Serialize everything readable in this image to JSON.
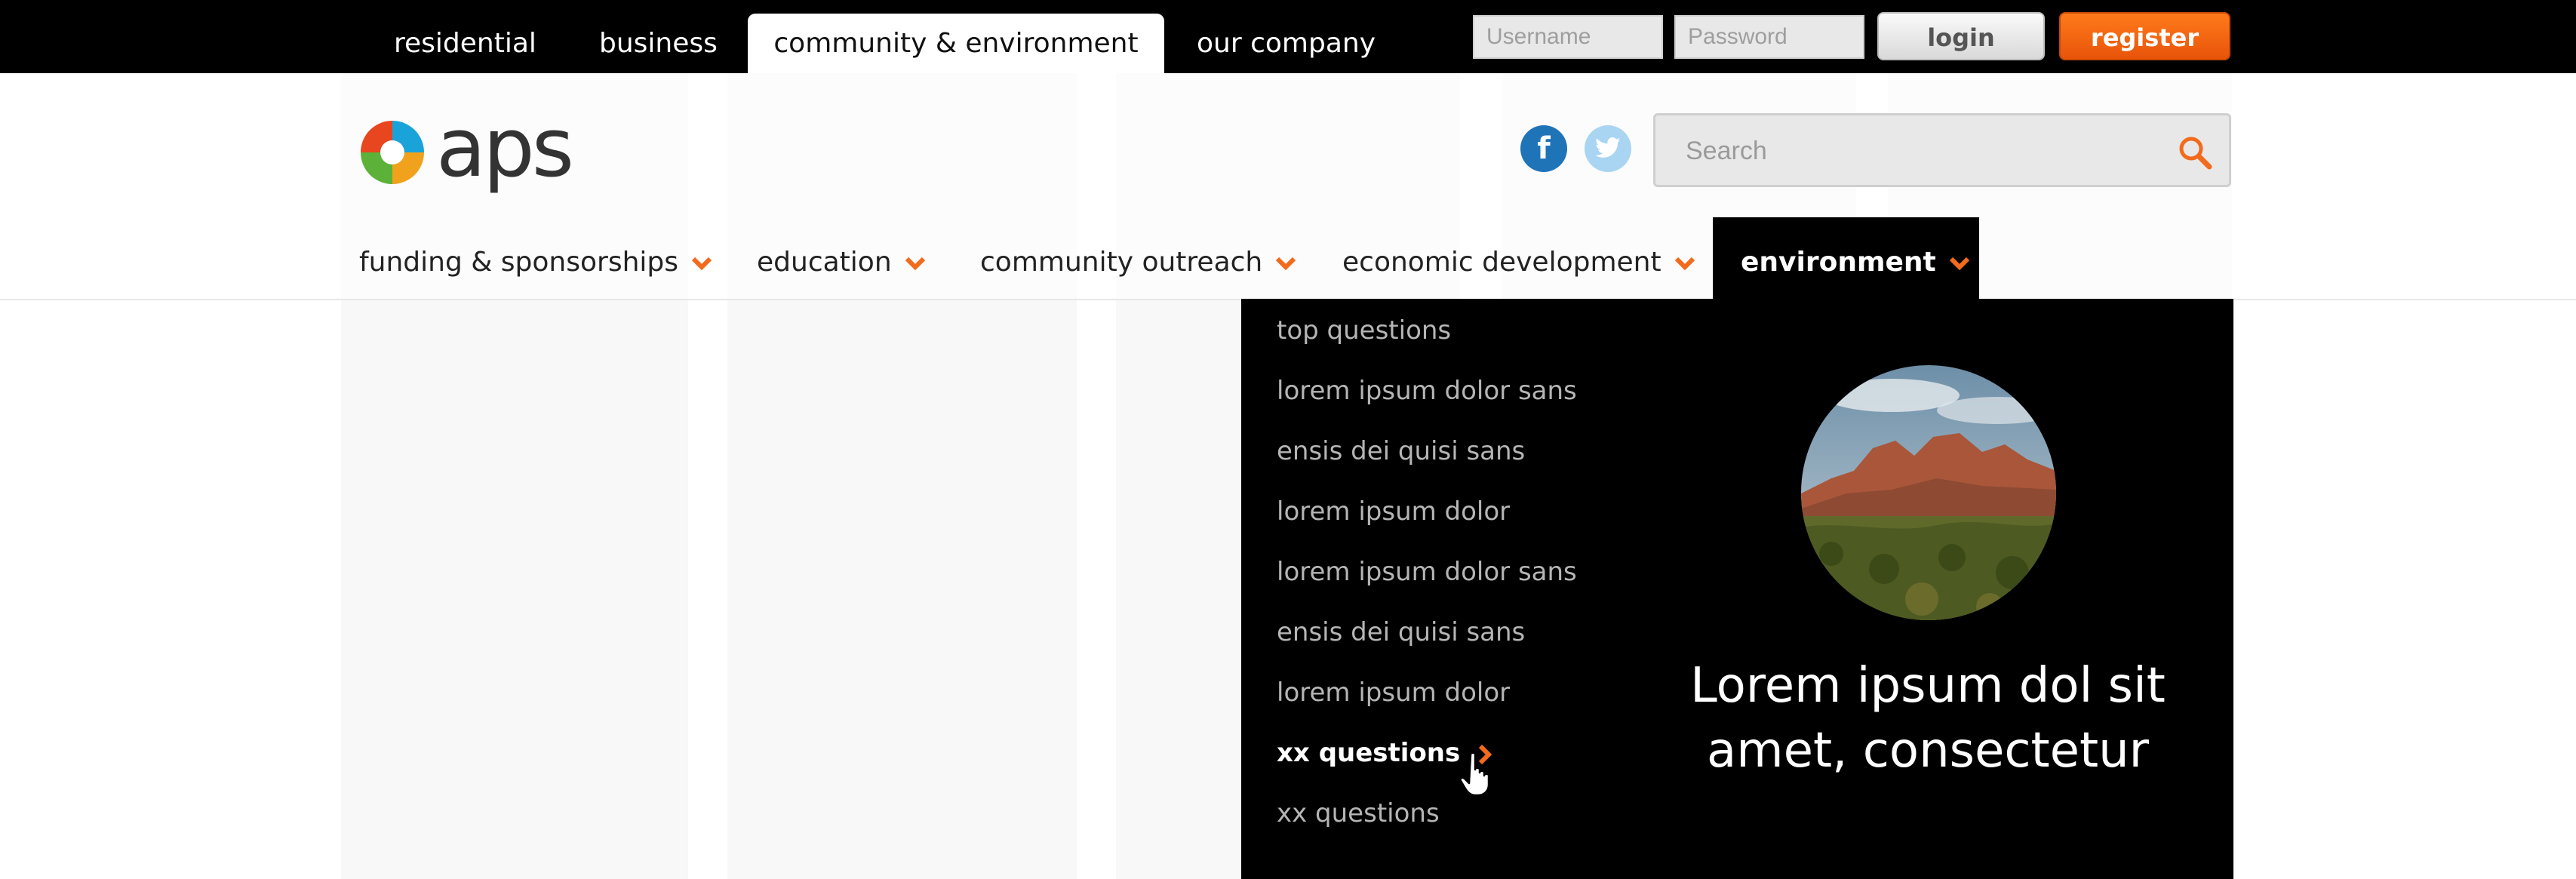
{
  "top_tabs": [
    "residential",
    "business",
    "community & environment",
    "our company"
  ],
  "login": {
    "username_placeholder": "Username",
    "password_placeholder": "Password",
    "login_label": "login",
    "register_label": "register"
  },
  "brand": {
    "logo_text": "aps"
  },
  "social": {
    "facebook": "f",
    "twitter": "t"
  },
  "search": {
    "placeholder": "Search"
  },
  "main_nav": [
    {
      "label": "funding & sponsorships"
    },
    {
      "label": "education"
    },
    {
      "label": "community outreach"
    },
    {
      "label": "economic development"
    },
    {
      "label": "environment"
    }
  ],
  "dropdown": {
    "items": [
      "top questions",
      "lorem ipsum dolor sans",
      "ensis dei quisi sans",
      "lorem ipsum dolor",
      "lorem ipsum dolor sans",
      "ensis dei quisi sans",
      "lorem ipsum dolor",
      "xx questions",
      "xx questions"
    ],
    "promo_line1": "Lorem ipsum dol sit",
    "promo_line2": "amet, consectetur"
  },
  "colors": {
    "accent": "#f26b1d",
    "facebook": "#1f74b8",
    "twitter": "#a9d5f2",
    "topbar": "#000000"
  }
}
